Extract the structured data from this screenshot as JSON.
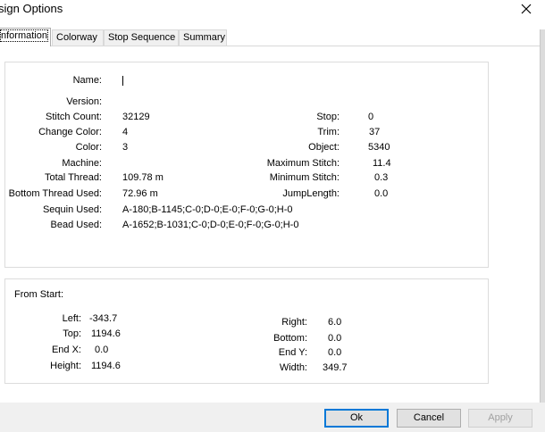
{
  "window": {
    "title": "sign Options"
  },
  "tabs": [
    {
      "label": "nformation",
      "active": true
    },
    {
      "label": "Colorway",
      "active": false
    },
    {
      "label": "Stop Sequence",
      "active": false
    },
    {
      "label": "Summary",
      "active": false
    }
  ],
  "info": {
    "name_label": "Name:",
    "name_value": "",
    "version_label": "Version:",
    "stitch_count_label": "Stitch Count:",
    "stitch_count_value": "32129",
    "change_color_label": "Change Color:",
    "change_color_value": "4",
    "color_label": "Color:",
    "color_value": "3",
    "machine_label": "Machine:",
    "total_thread_label": "Total Thread:",
    "total_thread_value": "109.78 m",
    "bottom_thread_label": "Bottom Thread Used:",
    "bottom_thread_value": "72.96 m",
    "sequin_label": "Sequin Used:",
    "sequin_value": "A-180;B-1145;C-0;D-0;E-0;F-0;G-0;H-0",
    "bead_label": "Bead Used:",
    "bead_value": "A-1652;B-1031;C-0;D-0;E-0;F-0;G-0;H-0",
    "stop_label": "Stop:",
    "stop_value": "0",
    "trim_label": "Trim:",
    "trim_value": "37",
    "object_label": "Object:",
    "object_value": "5340",
    "max_stitch_label": "Maximum Stitch:",
    "max_stitch_value": "11.4",
    "min_stitch_label": "Minimum Stitch:",
    "min_stitch_value": "0.3",
    "jump_length_label": "JumpLength:",
    "jump_length_value": "0.0"
  },
  "from_start": {
    "heading": "From Start:",
    "left_label": "Left:",
    "left_value": "-343.7",
    "top_label": "Top:",
    "top_value": "1194.6",
    "endx_label": "End X:",
    "endx_value": "0.0",
    "height_label": "Height:",
    "height_value": "1194.6",
    "right_label": "Right:",
    "right_value": "6.0",
    "bottom_label": "Bottom:",
    "bottom_value": "0.0",
    "endy_label": "End Y:",
    "endy_value": "0.0",
    "width_label": "Width:",
    "width_value": "349.7"
  },
  "buttons": {
    "ok": "Ok",
    "cancel": "Cancel",
    "apply": "Apply"
  },
  "icons": {
    "close": "close-icon"
  }
}
